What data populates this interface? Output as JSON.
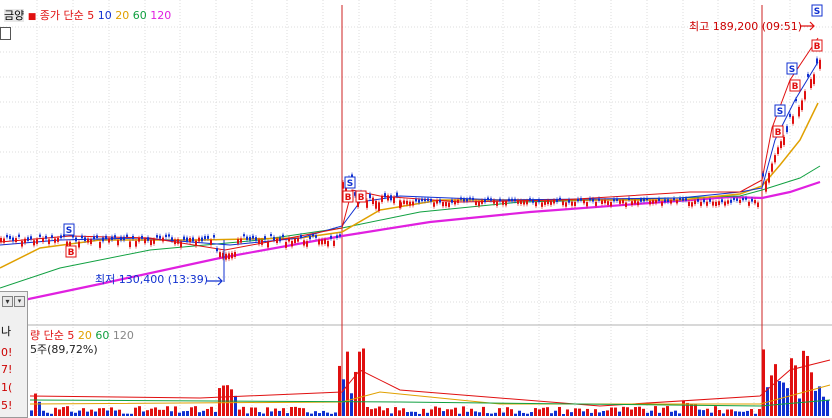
{
  "price_legend": {
    "title": "금양",
    "icon": "grid-icon",
    "ma_label": "종가 단순",
    "periods": [
      "5",
      "10",
      "20",
      "60",
      "120"
    ],
    "colors": [
      "#e01010",
      "#1030d0",
      "#e0a000",
      "#10a040",
      "#e020e0"
    ]
  },
  "high_label": "최고 189,200 (09:51)",
  "low_label": "최저 130,400 (13:39)",
  "volume_legend": {
    "label": "량",
    "ma_label": "단순",
    "periods": [
      "5",
      "20",
      "60",
      "120"
    ],
    "colors": [
      "#e01010",
      "#e0a000",
      "#10a040",
      "#888888"
    ],
    "volume_text": "5주(89,72%)"
  },
  "side_panel": {
    "rows": [
      "나",
      "0!",
      "7!",
      "1(",
      "5!"
    ]
  },
  "signals": {
    "sell_letter": "S",
    "buy_letter": "B"
  },
  "colors": {
    "up": "#e01010",
    "down": "#1030d0",
    "ma5": "#e01010",
    "ma10": "#1030d0",
    "ma20": "#e0a000",
    "ma60": "#10a040",
    "ma120": "#e020e0",
    "divider": "#cc2020",
    "grid": "#dcdcdc"
  }
}
